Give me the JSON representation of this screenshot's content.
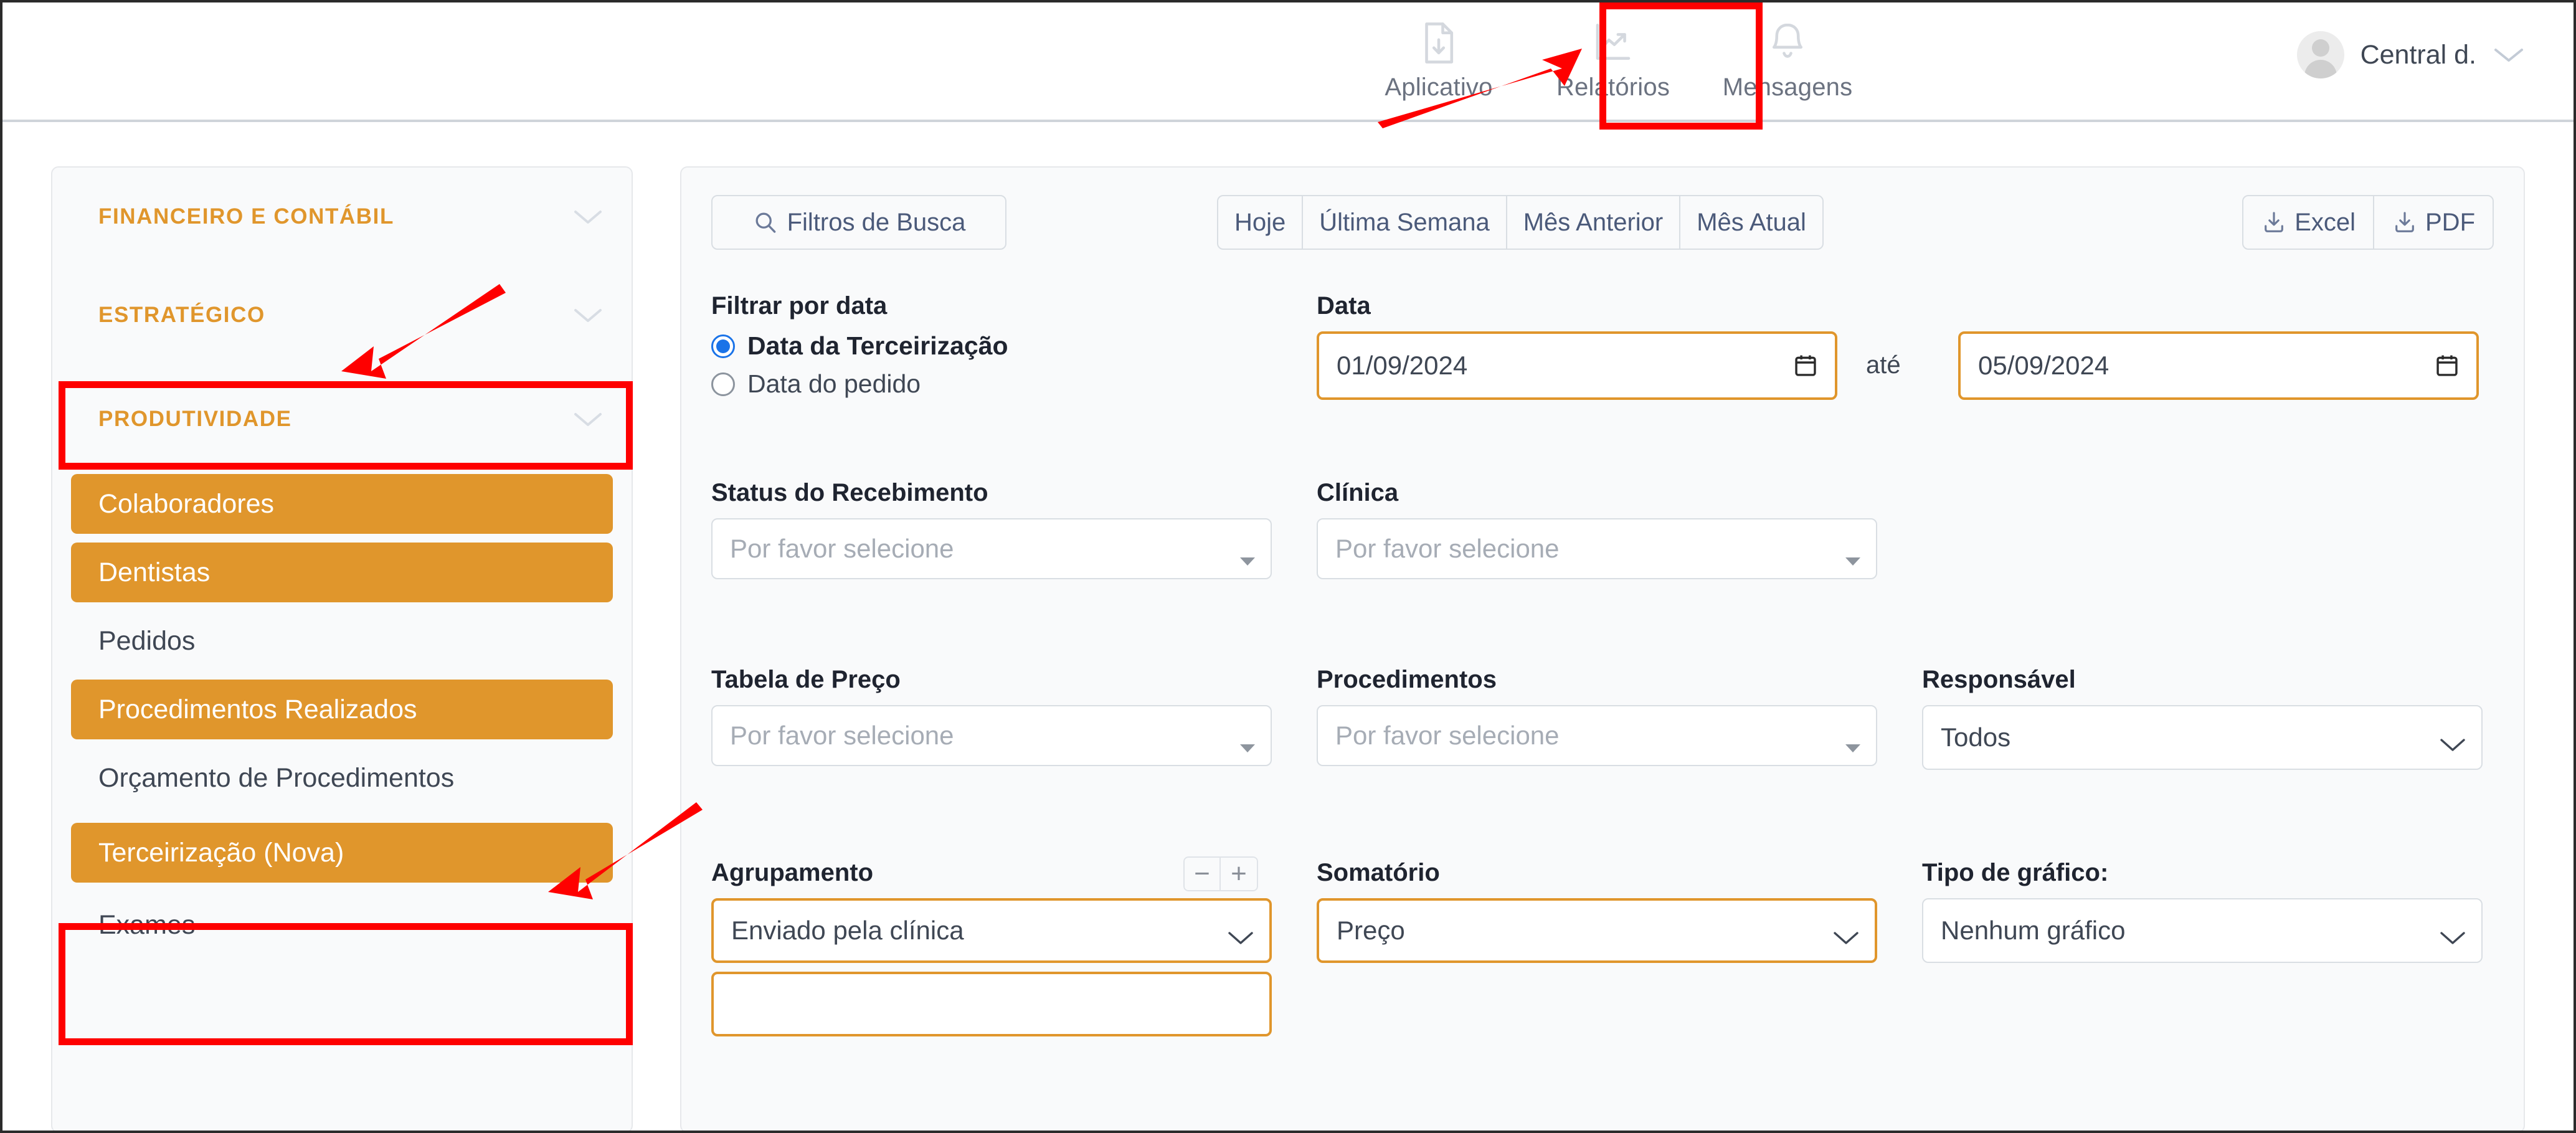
{
  "topnav": {
    "items": [
      {
        "label": "Aplicativo",
        "icon": "file-download-icon",
        "highlighted": false
      },
      {
        "label": "Relatórios",
        "icon": "report-chart-icon",
        "highlighted": true
      },
      {
        "label": "Mensagens",
        "icon": "bell-icon",
        "highlighted": false
      }
    ],
    "user": {
      "name": "Central d.",
      "avatar_icon": "avatar-icon",
      "caret_icon": "chevron-down-icon"
    }
  },
  "sidebar": {
    "groups": [
      {
        "label": "FINANCEIRO E CONTÁBIL",
        "caret_icon": "chevron-down-icon",
        "highlighted": false
      },
      {
        "label": "ESTRATÉGICO",
        "caret_icon": "chevron-down-icon",
        "highlighted": false
      },
      {
        "label": "PRODUTIVIDADE",
        "caret_icon": "chevron-down-icon",
        "highlighted": true
      }
    ],
    "items": [
      {
        "label": "Colaboradores",
        "active": true
      },
      {
        "label": "Dentistas",
        "active": true
      },
      {
        "label": "Pedidos",
        "active": false
      },
      {
        "label": "Procedimentos Realizados",
        "active": true
      },
      {
        "label": "Orçamento de Procedimentos",
        "active": false
      },
      {
        "label": "Terceirização (Nova)",
        "active": true,
        "highlighted": true
      },
      {
        "label": "Exames",
        "active": false
      }
    ]
  },
  "toolbar": {
    "filters_button": {
      "label": "Filtros de Busca",
      "icon": "search-icon"
    },
    "range_segments": [
      "Hoje",
      "Última Semana",
      "Mês Anterior",
      "Mês Atual"
    ],
    "exports": [
      {
        "label": "Excel",
        "icon": "download-icon"
      },
      {
        "label": "PDF",
        "icon": "download-icon"
      }
    ]
  },
  "form": {
    "filter_by_date": {
      "label": "Filtrar por data",
      "options": [
        {
          "label": "Data da Terceirização",
          "selected": true
        },
        {
          "label": "Data do pedido",
          "selected": false
        }
      ]
    },
    "date": {
      "label": "Data",
      "from_value": "01/09/2024",
      "separator": "até",
      "to_value": "05/09/2024",
      "calendar_icon": "calendar-icon"
    },
    "status_recebimento": {
      "label": "Status do Recebimento",
      "placeholder": "Por favor selecione",
      "value": ""
    },
    "clinica": {
      "label": "Clínica",
      "placeholder": "Por favor selecione",
      "value": ""
    },
    "tabela_preco": {
      "label": "Tabela de Preço",
      "placeholder": "Por favor selecione",
      "value": ""
    },
    "procedimentos": {
      "label": "Procedimentos",
      "placeholder": "Por favor selecione",
      "value": ""
    },
    "responsavel": {
      "label": "Responsável",
      "value": "Todos"
    },
    "agrupamento": {
      "label": "Agrupamento",
      "value": "Enviado pela clínica",
      "minus_label": "−",
      "plus_label": "+",
      "minus_icon": "minus-icon",
      "plus_icon": "plus-icon"
    },
    "somatorio": {
      "label": "Somatório",
      "value": "Preço"
    },
    "tipo_grafico": {
      "label": "Tipo de gráfico:",
      "value": "Nenhum gráfico"
    }
  },
  "colors": {
    "brand_orange": "#e0962c",
    "annotation_red": "#fe0000",
    "radio_blue": "#1a73e8",
    "panel_bg": "#f9fafb",
    "border_grey": "#d9dee3",
    "link_blue": "#4b5a7a"
  },
  "annotations": {
    "boxes": [
      {
        "target": "Relatórios"
      },
      {
        "target": "PRODUTIVIDADE"
      },
      {
        "target": "Terceirização (Nova)"
      }
    ],
    "arrows": [
      {
        "from": "Relatórios tab",
        "to": "Relatórios tab"
      },
      {
        "from": "right of FINANCEIRO",
        "to": "ESTRATÉGICO / PRODUTIVIDADE"
      },
      {
        "from": "right of Procedimentos Realizados",
        "to": "Orçamento de Procedimentos"
      }
    ]
  }
}
